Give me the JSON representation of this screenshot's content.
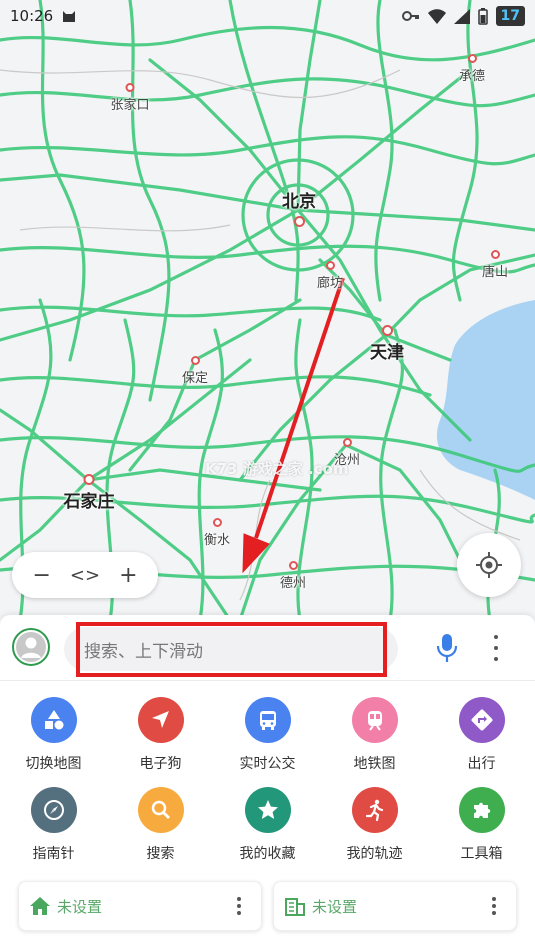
{
  "status_bar": {
    "time": "10:26",
    "badge": "17"
  },
  "map": {
    "cities": {
      "chengde": "承德",
      "zhangjiakou": "张家口",
      "beijing": "北京",
      "langfang": "廊坊",
      "tangshan": "唐山",
      "tianjin": "天津",
      "baoding": "保定",
      "cangzhou": "沧州",
      "shijiazhuang": "石家庄",
      "hengshui": "衡水",
      "dezhou": "德州"
    },
    "watermark": "K73 游戏之家 .com",
    "road_color": "#3ec97a",
    "water_color": "#aad3f3"
  },
  "zoom": {
    "minus": "−",
    "toggle": "<>",
    "plus": "+"
  },
  "search": {
    "placeholder": "搜索、上下滑动"
  },
  "quick_actions": [
    {
      "label": "切换地图",
      "icon": "shapes-icon",
      "color": "#4a82f0"
    },
    {
      "label": "电子狗",
      "icon": "navigation-arrow-icon",
      "color": "#e04b44"
    },
    {
      "label": "实时公交",
      "icon": "bus-icon",
      "color": "#4a82f0"
    },
    {
      "label": "地铁图",
      "icon": "subway-icon",
      "color": "#f27fa8"
    },
    {
      "label": "出行",
      "icon": "directions-icon",
      "color": "#8f59c7"
    },
    {
      "label": "指南针",
      "icon": "compass-icon",
      "color": "#546f7d"
    },
    {
      "label": "搜索",
      "icon": "search-icon",
      "color": "#f7ab3f"
    },
    {
      "label": "我的收藏",
      "icon": "star-icon",
      "color": "#23977a"
    },
    {
      "label": "我的轨迹",
      "icon": "runner-icon",
      "color": "#e04b44"
    },
    {
      "label": "工具箱",
      "icon": "puzzle-icon",
      "color": "#3fae4f"
    }
  ],
  "shortcuts": {
    "home": {
      "label": "未设置",
      "icon": "home-icon"
    },
    "work": {
      "label": "未设置",
      "icon": "office-building-icon"
    }
  },
  "annotation_color": "#e31f22"
}
